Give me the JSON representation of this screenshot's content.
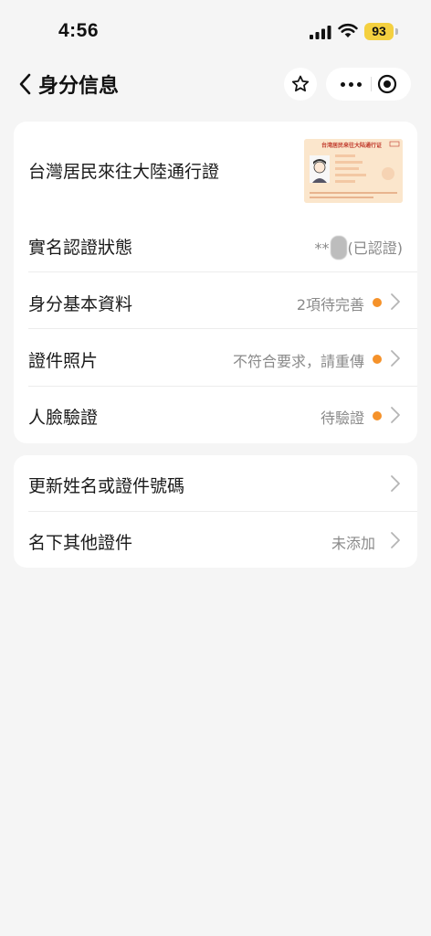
{
  "status_bar": {
    "time": "4:56",
    "battery": "93"
  },
  "nav": {
    "title": "身分信息"
  },
  "card1": {
    "document": {
      "title": "台灣居民來往大陸通行證",
      "thumb_header": "台湾居民来往大陆通行证"
    },
    "rows": [
      {
        "label": "實名認證狀態",
        "value_prefix": "**",
        "value": "(已認證)"
      },
      {
        "label": "身分基本資料",
        "value": "2項待完善"
      },
      {
        "label": "證件照片",
        "value": "不符合要求，請重傳"
      },
      {
        "label": "人臉驗證",
        "value": "待驗證"
      }
    ]
  },
  "card2": {
    "rows": [
      {
        "label": "更新姓名或證件號碼",
        "value": ""
      },
      {
        "label": "名下其他證件",
        "value": "未添加"
      }
    ]
  },
  "colors": {
    "accent_dot": "#f5922a",
    "background": "#f5f5f5",
    "battery": "#f4d03f"
  }
}
